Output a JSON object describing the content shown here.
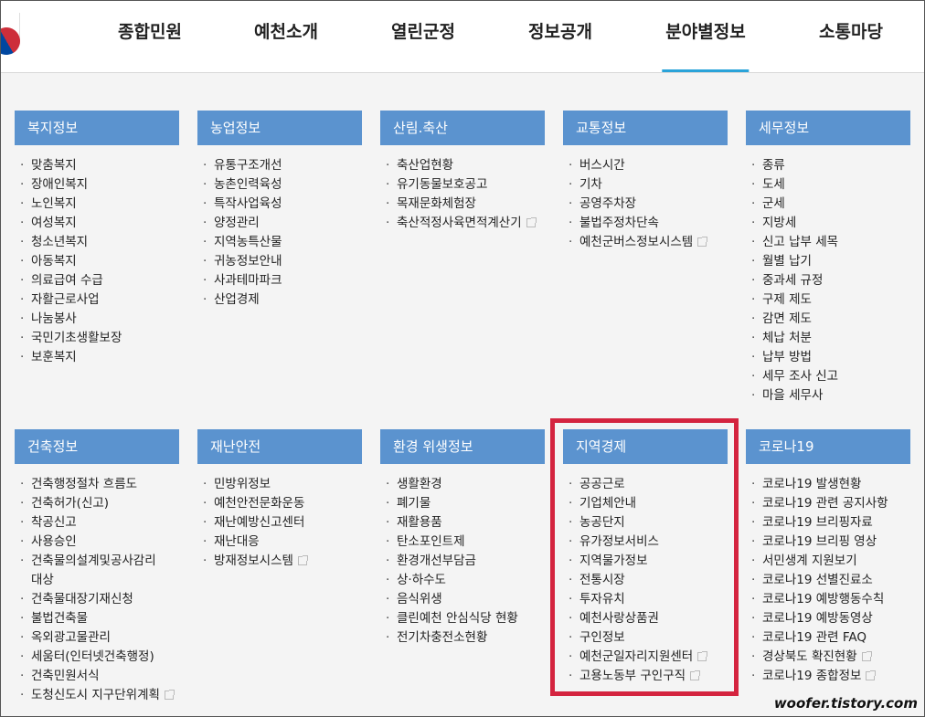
{
  "nav": {
    "items": [
      {
        "label": "종합민원",
        "active": false
      },
      {
        "label": "예천소개",
        "active": false
      },
      {
        "label": "열린군정",
        "active": false
      },
      {
        "label": "정보공개",
        "active": false
      },
      {
        "label": "분야별정보",
        "active": true
      },
      {
        "label": "소통마당",
        "active": false
      }
    ]
  },
  "sections": [
    {
      "title": "복지정보",
      "items": [
        "맞춤복지",
        "장애인복지",
        "노인복지",
        "여성복지",
        "청소년복지",
        "아동복지",
        "의료급여 수급",
        "자활근로사업",
        "나눔봉사",
        "국민기초생활보장",
        "보훈복지"
      ]
    },
    {
      "title": "농업정보",
      "items": [
        "유통구조개선",
        "농촌인력육성",
        "특작사업육성",
        "양정관리",
        "지역농특산물",
        "귀농정보안내",
        "사과테마파크",
        "산업경제"
      ]
    },
    {
      "title": "산림.축산",
      "items": [
        "축산업현황",
        "유기동물보호공고",
        "목재문화체험장",
        "축산적정사육면적계산기"
      ]
    },
    {
      "title": "교통정보",
      "items": [
        "버스시간",
        "기차",
        "공영주차장",
        "불법주정차단속",
        "예천군버스정보시스템"
      ]
    },
    {
      "title": "세무정보",
      "items": [
        "종류",
        "도세",
        "군세",
        "지방세",
        "신고 납부 세목",
        "월별 납기",
        "중과세 규정",
        "구제 제도",
        "감면 제도",
        "체납 처분",
        "납부 방법",
        "세무 조사 신고",
        "마을 세무사"
      ]
    },
    {
      "title": "건축정보",
      "items": [
        "건축행정절차 흐름도",
        "건축허가(신고)",
        "착공신고",
        "사용승인",
        "건축물의설계및공사감리대상",
        "건축물대장기재신청",
        "불법건축물",
        "옥외광고물관리",
        "세움터(인터넷건축행정)",
        "건축민원서식",
        "도청신도시 지구단위계획"
      ]
    },
    {
      "title": "재난안전",
      "items": [
        "민방위정보",
        "예천안전문화운동",
        "재난예방신고센터",
        "재난대응",
        "방재정보시스템"
      ]
    },
    {
      "title": "환경 위생정보",
      "items": [
        "생활환경",
        "폐기물",
        "재활용품",
        "탄소포인트제",
        "환경개선부담금",
        "상·하수도",
        "음식위생",
        "클린예천 안심식당 현황",
        "전기차충전소현황"
      ]
    },
    {
      "title": "지역경제",
      "items": [
        "공공근로",
        "기업체안내",
        "농공단지",
        "유가정보서비스",
        "지역물가정보",
        "전통시장",
        "투자유치",
        "예천사랑상품권",
        "구인정보",
        "예천군일자리지원센터",
        "고용노동부 구인구직"
      ]
    },
    {
      "title": "코로나19",
      "items": [
        "코로나19 발생현황",
        "코로나19 관련 공지사항",
        "코로나19 브리핑자료",
        "코로나19 브리핑 영상",
        "서민생계 지원보기",
        "코로나19 선별진료소",
        "코로나19 예방행동수칙",
        "코로나19 예방동영상",
        "코로나19 관련 FAQ",
        "경상북도 확진현황",
        "코로나19 종합정보"
      ]
    }
  ],
  "watermark": "woofer.tistory.com"
}
